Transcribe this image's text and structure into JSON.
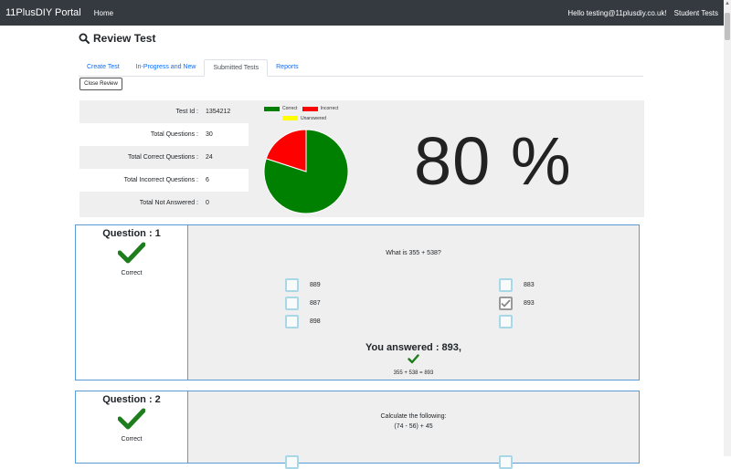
{
  "navbar": {
    "brand": "11PlusDIY Portal",
    "home": "Home",
    "greeting": "Hello testing@11plusdiy.co.uk!",
    "student_tests": "Student Tests"
  },
  "page": {
    "title": "Review Test",
    "icon": "search-icon"
  },
  "tabs": [
    {
      "label": "Create Test",
      "active": false
    },
    {
      "label": "In-Progress and New",
      "active": false
    },
    {
      "label": "Submitted Tests",
      "active": true
    },
    {
      "label": "Reports",
      "active": false
    }
  ],
  "close_button": "Close Review",
  "summary": {
    "stats": [
      {
        "label": "Test Id :",
        "value": "1354212"
      },
      {
        "label": "Total Questions :",
        "value": "30"
      },
      {
        "label": "Total Correct Questions :",
        "value": "24"
      },
      {
        "label": "Total Incorrect Questions :",
        "value": "6"
      },
      {
        "label": "Total Not Answered :",
        "value": "0"
      }
    ],
    "legend": {
      "correct": "Correct",
      "incorrect": "Incorrect",
      "unanswered": "Unanswered"
    },
    "pie": {
      "correct": 24,
      "incorrect": 6,
      "unanswered": 0
    },
    "colors": {
      "correct": "#008000",
      "incorrect": "#ff0000",
      "unanswered": "#ffff00"
    },
    "score": "80 %"
  },
  "questions": [
    {
      "title": "Question : 1",
      "status": "Correct",
      "text": "What is 355 + 538?",
      "options_left": [
        "889",
        "887",
        "898"
      ],
      "options_right": [
        "883",
        "893",
        ""
      ],
      "checked": "893",
      "answer": "You answered : 893,",
      "explanation": "355 + 538 = 893"
    },
    {
      "title": "Question : 2",
      "status": "Correct",
      "text_line1": "Calculate the following:",
      "text_line2": "(74 - 56) + 45"
    }
  ]
}
